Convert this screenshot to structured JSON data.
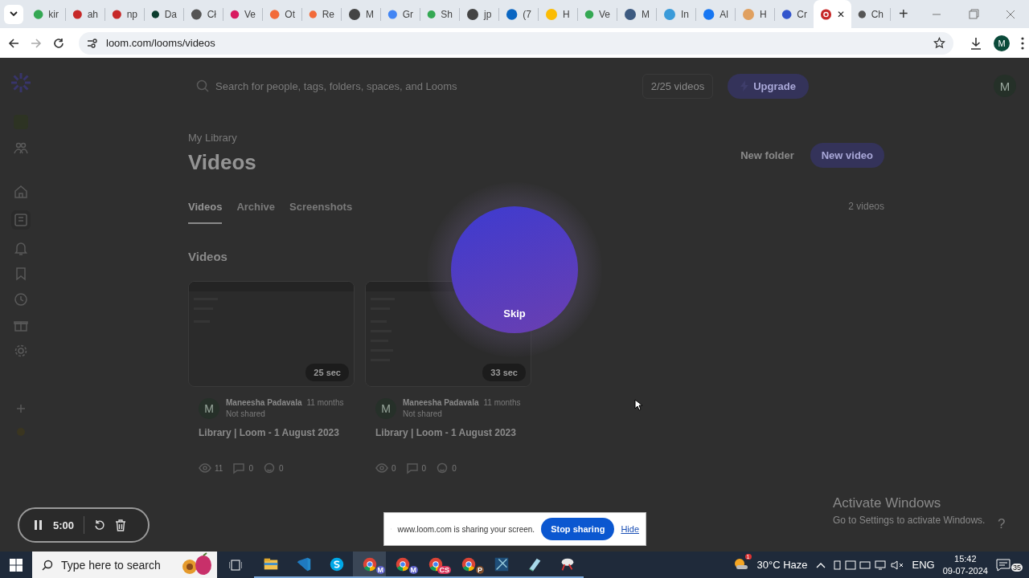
{
  "browser": {
    "tabs": [
      {
        "label": "kir",
        "color": "#34a853",
        "selected": false
      },
      {
        "label": "ah",
        "color": "#c62828",
        "selected": false
      },
      {
        "label": "np",
        "color": "#c62828",
        "selected": false
      },
      {
        "label": "Da",
        "color": "#0b3d2e",
        "selected": false
      },
      {
        "label": "Cł",
        "color": "#555555",
        "selected": false
      },
      {
        "label": "Ve",
        "color": "#d81b60",
        "selected": false
      },
      {
        "label": "Ot",
        "color": "#f26b3a",
        "selected": false
      },
      {
        "label": "Re",
        "color": "#f26b3a",
        "selected": false
      },
      {
        "label": "M",
        "color": "#444444",
        "selected": false
      },
      {
        "label": "Gr",
        "color": "#4285f4",
        "selected": false
      },
      {
        "label": "Sh",
        "color": "#34a853",
        "selected": false
      },
      {
        "label": "jp",
        "color": "#444444",
        "selected": false
      },
      {
        "label": "(7",
        "color": "#0a66c2",
        "selected": false
      },
      {
        "label": "H",
        "color": "#fbbc04",
        "selected": false
      },
      {
        "label": "Ve",
        "color": "#34a853",
        "selected": false
      },
      {
        "label": "M",
        "color": "#3d5a80",
        "selected": false
      },
      {
        "label": "In",
        "color": "#3b9bd9",
        "selected": false
      },
      {
        "label": "Al",
        "color": "#1877f2",
        "selected": false
      },
      {
        "label": "H",
        "color": "#e0a060",
        "selected": false
      },
      {
        "label": "Cr",
        "color": "#3355cc",
        "selected": false
      },
      {
        "color": "#c62828",
        "selected": true
      },
      {
        "label": "Ch",
        "color": "#555555",
        "selected": false
      }
    ],
    "close": "✕",
    "new_tab": "+",
    "address": "loom.com/looms/videos",
    "profile": "M"
  },
  "loom": {
    "search": {
      "placeholder": "Search for people, tags, folders, spaces, and Looms"
    },
    "usage": "2/25 videos",
    "upgrade": "Upgrade",
    "avatar": "M",
    "breadcrumb": "My Library",
    "title": "Videos",
    "tabs": [
      {
        "label": "Videos",
        "selected": true
      },
      {
        "label": "Archive",
        "selected": false
      },
      {
        "label": "Screenshots",
        "selected": false
      }
    ],
    "new_folder": "New folder",
    "new_video": "New video",
    "count": "2 videos",
    "section": "Videos",
    "cards": [
      {
        "duration": "25 sec",
        "avatar": "M",
        "author": "Maneesha Padavala",
        "time": "11 months",
        "sharing": "Not shared",
        "title": "Library | Loom - 1 August 2023",
        "stats": [
          "11",
          "0",
          "0"
        ]
      },
      {
        "duration": "33 sec",
        "avatar": "M",
        "author": "Maneesha Padavala",
        "time": "11 months",
        "sharing": "Not shared",
        "title": "Library | Loom - 1 August 2023",
        "stats": [
          "0",
          "0",
          "0"
        ]
      }
    ]
  },
  "countdown": {
    "skip": "Skip"
  },
  "recorder": {
    "time": "5:00"
  },
  "share_bar": {
    "message": "www.loom.com is sharing your screen.",
    "stop": "Stop sharing",
    "hide": "Hide"
  },
  "activation": {
    "title": "Activate Windows",
    "hint": "Go to Settings to activate Windows.",
    "help": "?"
  },
  "taskbar": {
    "search_placeholder": "Type here to search",
    "apps": [
      {
        "kind": "explorer",
        "selected": false
      },
      {
        "kind": "vscode",
        "selected": false
      },
      {
        "kind": "skype",
        "selected": false
      },
      {
        "kind": "chrome",
        "badge": "M",
        "selected": true
      },
      {
        "kind": "chrome",
        "badge": "M",
        "selected": false
      },
      {
        "kind": "chrome",
        "badge": "CS",
        "selected": false
      },
      {
        "kind": "chrome",
        "badge": "P",
        "selected": false
      },
      {
        "kind": "tool",
        "selected": false
      },
      {
        "kind": "notes",
        "selected": false
      },
      {
        "kind": "paint",
        "selected": false
      }
    ],
    "weather": "30°C Haze",
    "weather_badge": "1",
    "language": "ENG",
    "time": "15:42",
    "date": "09-07-2024",
    "notifications": "35"
  }
}
